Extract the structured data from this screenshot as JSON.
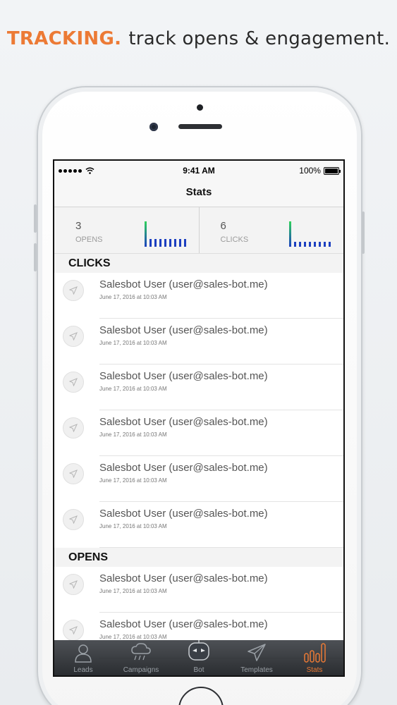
{
  "headline": {
    "accent": "TRACKING.",
    "text": "track opens & engagement."
  },
  "status": {
    "time": "9:41 AM",
    "battery": "100%"
  },
  "nav": {
    "title": "Stats"
  },
  "summary": [
    {
      "count": "3",
      "label": "OPENS",
      "sparkline": [
        1,
        0.3,
        0.3,
        0.3,
        0.3,
        0.3,
        0.3,
        0.3,
        0.3
      ]
    },
    {
      "count": "6",
      "label": "CLICKS",
      "sparkline": [
        1,
        0.2,
        0.2,
        0.2,
        0.2,
        0.2,
        0.2,
        0.2,
        0.2
      ]
    }
  ],
  "sections": {
    "clicks": {
      "title": "CLICKS",
      "items": [
        {
          "name": "Salesbot User (user@sales-bot.me)",
          "date": "June 17, 2016 at 10:03 AM"
        },
        {
          "name": "Salesbot User (user@sales-bot.me)",
          "date": "June 17, 2016 at 10:03 AM"
        },
        {
          "name": "Salesbot User (user@sales-bot.me)",
          "date": "June 17, 2016 at 10:03 AM"
        },
        {
          "name": "Salesbot User (user@sales-bot.me)",
          "date": "June 17, 2016 at 10:03 AM"
        },
        {
          "name": "Salesbot User (user@sales-bot.me)",
          "date": "June 17, 2016 at 10:03 AM"
        },
        {
          "name": "Salesbot User (user@sales-bot.me)",
          "date": "June 17, 2016 at 10:03 AM"
        }
      ]
    },
    "opens": {
      "title": "OPENS",
      "items": [
        {
          "name": "Salesbot User (user@sales-bot.me)",
          "date": "June 17, 2016 at 10:03 AM"
        },
        {
          "name": "Salesbot User (user@sales-bot.me)",
          "date": "June 17, 2016 at 10:03 AM"
        }
      ]
    }
  },
  "tabs": [
    {
      "label": "Leads",
      "icon": "person-icon"
    },
    {
      "label": "Campaigns",
      "icon": "cloud-rain-icon"
    },
    {
      "label": "Bot",
      "icon": "robot-icon"
    },
    {
      "label": "Templates",
      "icon": "paper-plane-icon"
    },
    {
      "label": "Stats",
      "icon": "bar-chart-icon",
      "active": true
    }
  ],
  "colors": {
    "accent": "#ec7a35",
    "spark_blue": "#1c3fc0",
    "spark_green": "#2fd35a"
  }
}
